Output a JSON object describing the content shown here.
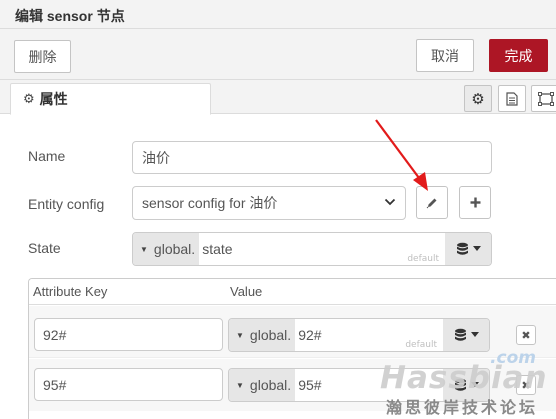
{
  "dialog": {
    "title": "编辑 sensor 节点"
  },
  "toolbar": {
    "delete_label": "删除",
    "cancel_label": "取消",
    "done_label": "完成",
    "done_color": "#ad1625"
  },
  "tabs": {
    "properties_label": "属性"
  },
  "form": {
    "name_label": "Name",
    "name_value": "油价",
    "entity_config_label": "Entity config",
    "entity_config_value": "sensor config for 油价",
    "state_label": "State",
    "state_type": "global.",
    "state_value": "state",
    "state_default_hint": "default"
  },
  "attributes": {
    "key_header": "Attribute Key",
    "value_header": "Value",
    "rows": [
      {
        "key": "92#",
        "type": "global.",
        "value": "92#",
        "hint": "default"
      },
      {
        "key": "95#",
        "type": "global.",
        "value": "95#",
        "hint": ""
      }
    ]
  },
  "watermark": {
    "com": ".com",
    "main": "Hassbian",
    "sub": "瀚思彼岸技术论坛"
  },
  "icons": [
    "gear-icon",
    "document-icon",
    "image-icon",
    "pencil-icon",
    "plus-icon",
    "caret-down-icon",
    "database-icon",
    "close-icon",
    "red-arrow-annotation"
  ]
}
